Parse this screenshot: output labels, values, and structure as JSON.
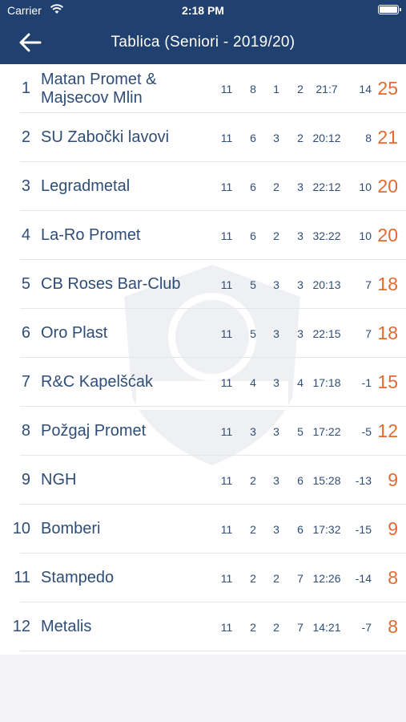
{
  "status": {
    "carrier": "Carrier",
    "time": "2:18 PM"
  },
  "header": {
    "title": "Tablica (Seniori - 2019/20)"
  },
  "colors": {
    "bar": "#20406f",
    "text": "#2f4d76",
    "points": "#e36a2c"
  },
  "standings": [
    {
      "rank": "1",
      "name": "Matan Promet & Majsecov Mlin",
      "played": "11",
      "won": "8",
      "drawn": "1",
      "lost": "2",
      "goals": "21:7",
      "diff": "14",
      "points": "25"
    },
    {
      "rank": "2",
      "name": "SU Zabočki lavovi",
      "played": "11",
      "won": "6",
      "drawn": "3",
      "lost": "2",
      "goals": "20:12",
      "diff": "8",
      "points": "21"
    },
    {
      "rank": "3",
      "name": "Legradmetal",
      "played": "11",
      "won": "6",
      "drawn": "2",
      "lost": "3",
      "goals": "22:12",
      "diff": "10",
      "points": "20"
    },
    {
      "rank": "4",
      "name": "La-Ro Promet",
      "played": "11",
      "won": "6",
      "drawn": "2",
      "lost": "3",
      "goals": "32:22",
      "diff": "10",
      "points": "20"
    },
    {
      "rank": "5",
      "name": "CB Roses Bar-Club",
      "played": "11",
      "won": "5",
      "drawn": "3",
      "lost": "3",
      "goals": "20:13",
      "diff": "7",
      "points": "18"
    },
    {
      "rank": "6",
      "name": "Oro Plast",
      "played": "11",
      "won": "5",
      "drawn": "3",
      "lost": "3",
      "goals": "22:15",
      "diff": "7",
      "points": "18"
    },
    {
      "rank": "7",
      "name": "R&C Kapelšćak",
      "played": "11",
      "won": "4",
      "drawn": "3",
      "lost": "4",
      "goals": "17:18",
      "diff": "-1",
      "points": "15"
    },
    {
      "rank": "8",
      "name": "Požgaj Promet",
      "played": "11",
      "won": "3",
      "drawn": "3",
      "lost": "5",
      "goals": "17:22",
      "diff": "-5",
      "points": "12"
    },
    {
      "rank": "9",
      "name": "NGH",
      "played": "11",
      "won": "2",
      "drawn": "3",
      "lost": "6",
      "goals": "15:28",
      "diff": "-13",
      "points": "9"
    },
    {
      "rank": "10",
      "name": "Bomberi",
      "played": "11",
      "won": "2",
      "drawn": "3",
      "lost": "6",
      "goals": "17:32",
      "diff": "-15",
      "points": "9"
    },
    {
      "rank": "11",
      "name": "Stampedo",
      "played": "11",
      "won": "2",
      "drawn": "2",
      "lost": "7",
      "goals": "12:26",
      "diff": "-14",
      "points": "8"
    },
    {
      "rank": "12",
      "name": "Metalis",
      "played": "11",
      "won": "2",
      "drawn": "2",
      "lost": "7",
      "goals": "14:21",
      "diff": "-7",
      "points": "8"
    }
  ]
}
